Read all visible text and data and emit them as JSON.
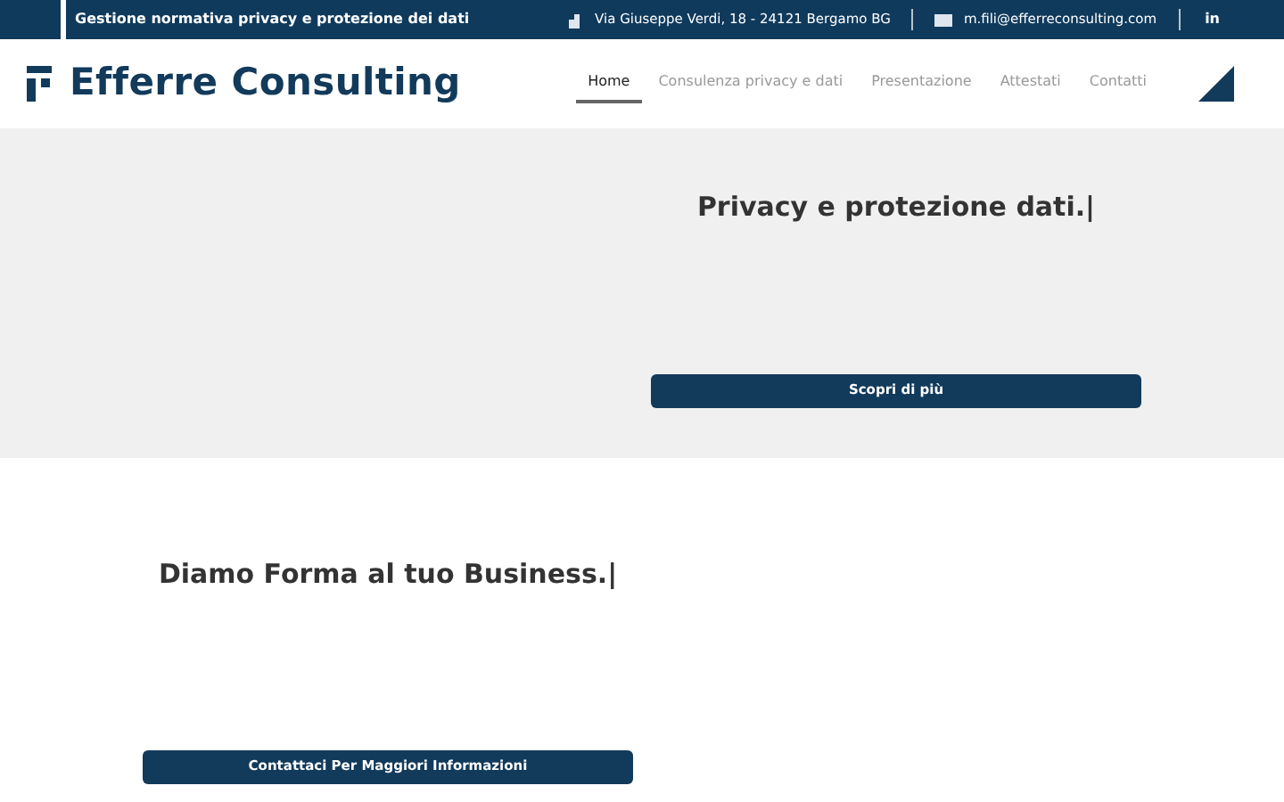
{
  "top_bar": {
    "tagline": "Gestione normativa privacy e protezione dei dati",
    "address": "Via Giuseppe Verdi, 18 - 24121 Bergamo BG",
    "email": "m.fili@efferreconsulting.com",
    "social": "in"
  },
  "header": {
    "logo_text": "Efferre Consulting",
    "nav": [
      {
        "label": "Home",
        "selected": true
      },
      {
        "label": "Consulenza privacy e dati",
        "selected": false
      },
      {
        "label": "Presentazione",
        "selected": false
      },
      {
        "label": "Attestati",
        "selected": false
      },
      {
        "label": "Contatti",
        "selected": false
      }
    ]
  },
  "hero": {
    "heading": "Privacy e protezione dati.|",
    "button": "Scopri di più"
  },
  "section": {
    "heading": "Diamo Forma al tuo Business.|",
    "button": "Contattaci Per Maggiori Informazioni"
  }
}
